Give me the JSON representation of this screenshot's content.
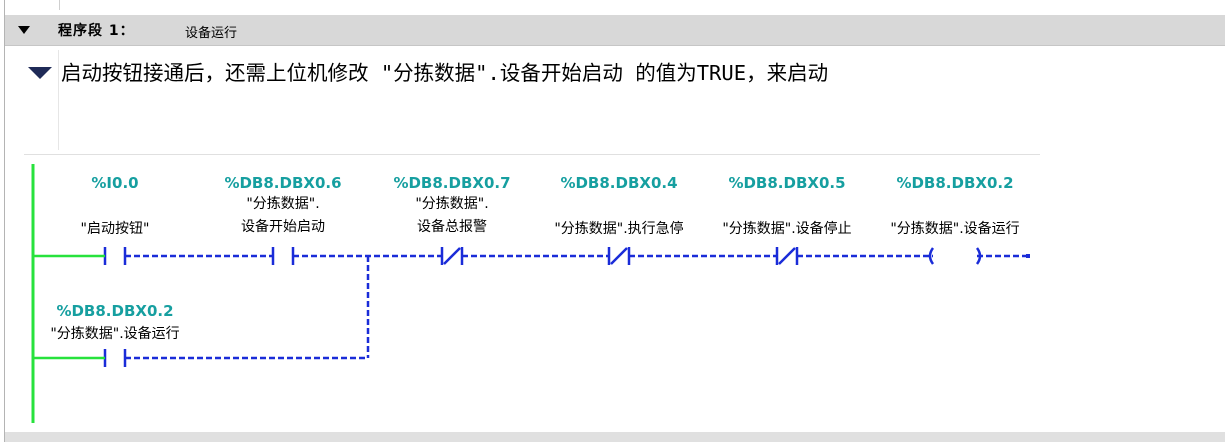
{
  "network": {
    "label": "程序段 1：",
    "title": "设备运行",
    "comment": "启动按钮接通后，还需上位机修改 \"分拣数据\".设备开始启动 的值为TRUE，来启动"
  },
  "rung1": [
    {
      "address": "%I0.0",
      "symbol1": "\"启动按钮\"",
      "symbol2": "",
      "kind": "no"
    },
    {
      "address": "%DB8.DBX0.6",
      "symbol1": "\"分拣数据\".",
      "symbol2": "设备开始启动",
      "kind": "no"
    },
    {
      "address": "%DB8.DBX0.7",
      "symbol1": "\"分拣数据\".",
      "symbol2": "设备总报警",
      "kind": "nc"
    },
    {
      "address": "%DB8.DBX0.4",
      "symbol1": "\"分拣数据\".执行急停",
      "symbol2": "",
      "kind": "nc"
    },
    {
      "address": "%DB8.DBX0.5",
      "symbol1": "\"分拣数据\".设备停止",
      "symbol2": "",
      "kind": "nc"
    },
    {
      "address": "%DB8.DBX0.2",
      "symbol1": "\"分拣数据\".设备运行",
      "symbol2": "",
      "kind": "coil"
    }
  ],
  "branch": [
    {
      "address": "%DB8.DBX0.2",
      "symbol1": "\"分拣数据\".设备运行",
      "symbol2": "",
      "kind": "no"
    }
  ],
  "colors": {
    "address": "#169fa0",
    "wire": "#1a2cd8",
    "power_rail": "#27e23c",
    "header_bg": "#d8d8d8"
  }
}
